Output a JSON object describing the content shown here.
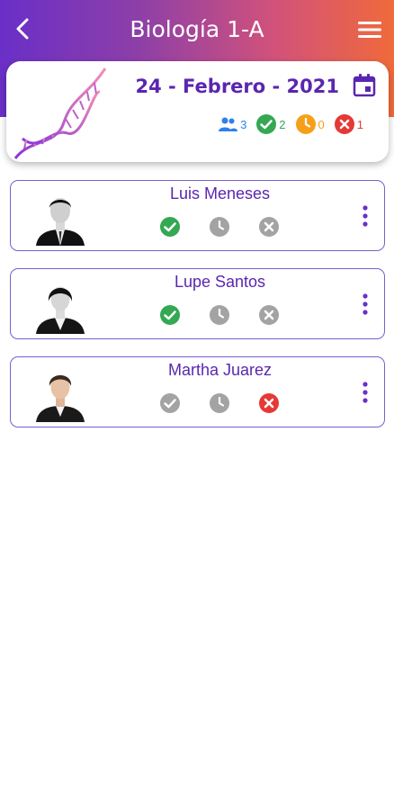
{
  "header": {
    "title": "Biología 1-A"
  },
  "date_card": {
    "date": "24 - Febrero - 2021",
    "stats": {
      "total": "3",
      "present": "2",
      "late": "0",
      "absent": "1"
    }
  },
  "colors": {
    "present": "#34a853",
    "late": "#f6a01a",
    "absent": "#e53935",
    "inactive": "#a3a3a3",
    "accent": "#5a26b0"
  },
  "students": [
    {
      "name": "Luis Meneses",
      "status": "present"
    },
    {
      "name": "Lupe Santos",
      "status": "present"
    },
    {
      "name": "Martha Juarez",
      "status": "absent"
    }
  ]
}
